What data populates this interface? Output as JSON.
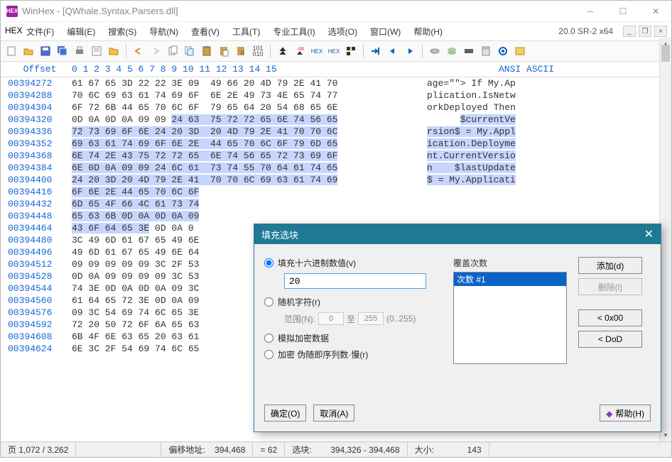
{
  "title": "WinHex - [QWhale.Syntax.Parsers.dll]",
  "version": "20.0 SR-2 x64",
  "menus": [
    "文件(F)",
    "编辑(E)",
    "搜索(S)",
    "导航(N)",
    "查看(V)",
    "工具(T)",
    "专业工具(I)",
    "选项(O)",
    "窗口(W)",
    "帮助(H)"
  ],
  "header": {
    "offset": "Offset",
    "cols": "0  1  2  3  4  5  6  7   8  9 10 11 12 13 14 15",
    "ascii": "ANSI ASCII"
  },
  "rows": [
    {
      "o": "00394272",
      "h": "61 67 65 3D 22 22 3E 09  49 66 20 4D 79 2E 41 70",
      "a": "age=\"\"> If My.Ap"
    },
    {
      "o": "00394288",
      "h": "70 6C 69 63 61 74 69 6F  6E 2E 49 73 4E 65 74 77",
      "a": "plication.IsNetw"
    },
    {
      "o": "00394304",
      "h": "6F 72 6B 44 65 70 6C 6F  79 65 64 20 54 68 65 6E",
      "a": "orkDeployed Then"
    },
    {
      "o": "00394320",
      "h": "0D 0A 0D 0A 09 09 ",
      "h2": "24 63  75 72 72 65 6E 74 56 65",
      "a": "      ",
      "a2": "$currentVe"
    },
    {
      "o": "00394336",
      "h": "",
      "h2": "72 73 69 6F 6E 24 20 3D  20 4D 79 2E 41 70 70 6C",
      "a": "",
      "a2": "rsion$ = My.Appl"
    },
    {
      "o": "00394352",
      "h": "",
      "h2": "69 63 61 74 69 6F 6E 2E  44 65 70 6C 6F 79 6D 65",
      "a": "",
      "a2": "ication.Deployme"
    },
    {
      "o": "00394368",
      "h": "",
      "h2": "6E 74 2E 43 75 72 72 65  6E 74 56 65 72 73 69 6F",
      "a": "",
      "a2": "nt.CurrentVersio"
    },
    {
      "o": "00394384",
      "h": "",
      "h2": "6E 0D 0A 09 09 24 6C 61  73 74 55 70 64 61 74 65",
      "a": "",
      "a2": "n    $lastUpdate"
    },
    {
      "o": "00394400",
      "h": "",
      "h2": "24 20 3D 20 4D 79 2E 41  70 70 6C 69 63 61 74 69",
      "a": "",
      "a2": "$ = My.Applicati"
    },
    {
      "o": "00394416",
      "h": "",
      "h2": "6F 6E 2E 44 65 70 6C 6F",
      "hr": "",
      "a": "",
      "a2": "",
      "ar": ""
    },
    {
      "o": "00394432",
      "h": "",
      "h2": "6D 65 4F 66 4C 61 73 74",
      "hr": "",
      "a": ""
    },
    {
      "o": "00394448",
      "h": "",
      "h2": "65 63 6B 0D 0A 0D 0A 09",
      "hr": "",
      "a": ""
    },
    {
      "o": "00394464",
      "h": "",
      "h2": "43 6F 64 65 3E",
      "hr": " 0D 0A 0",
      "a": ""
    },
    {
      "o": "00394480",
      "h": "3C 49 6D 61 67 65 49 6E",
      "a": ""
    },
    {
      "o": "00394496",
      "h": "49 6D 61 67 65 49 6E 64",
      "a": ""
    },
    {
      "o": "00394512",
      "h": "09 09 09 09 09 3C 2F 53",
      "a": ""
    },
    {
      "o": "00394528",
      "h": "0D 0A 09 09 09 09 3C 53",
      "a": ""
    },
    {
      "o": "00394544",
      "h": "74 3E 0D 0A 0D 0A 09 3C",
      "a": ""
    },
    {
      "o": "00394560",
      "h": "61 64 65 72 3E 0D 0A 09",
      "a": ""
    },
    {
      "o": "00394576",
      "h": "09 3C 54 69 74 6C 65 3E",
      "a": ""
    },
    {
      "o": "00394592",
      "h": "72 20 50 72 6F 6A 65 63",
      "a": ""
    },
    {
      "o": "00394608",
      "h": "6B 4F 6E 63 65 20 63 61",
      "a": ""
    },
    {
      "o": "00394624",
      "h": "6E 3C 2F 54 69 74 6C 65",
      "a": ""
    }
  ],
  "status": {
    "page": "页 1,072 / 3,262",
    "offlbl": "偏移地址:",
    "off": "394,468",
    "eq": "= 62",
    "sellbl": "选块:",
    "sel": "394,326 - 394,468",
    "sizelbl": "大小:",
    "size": "143"
  },
  "dialog": {
    "title": "填充选块",
    "r_hex": "填充十六进制数值(v)",
    "hexval": "20",
    "r_rand": "随机字符(r)",
    "rangelbl": "范围(N):",
    "r0": "0",
    "to": "至",
    "r1": "255",
    "rhint": "(0..255)",
    "r_sim": "模拟加密数据",
    "r_enc": "加密 伪随即序列数·慢(r)",
    "passlbl": "覆盖次数",
    "passitem": "次数 #1",
    "add": "添加(d)",
    "del": "删除(l)",
    "zero": "< 0x00",
    "dod": "< DoD",
    "ok": "确定(O)",
    "cancel": "取消(A)",
    "help": "帮助(H)"
  }
}
